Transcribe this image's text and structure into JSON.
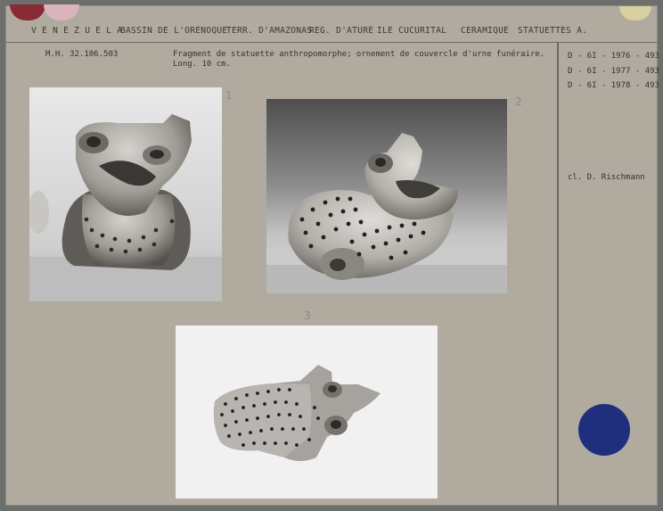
{
  "header": {
    "country": "V E N E Z U E L A",
    "region": "BASSIN DE L'ORENOQUE",
    "territory": "TERR. D'AMAZONAS",
    "reg": "REG. D'ATURE",
    "site": "ILE CUCURITAL",
    "category": "CERAMIQUE",
    "subcategory": "STATUETTES A."
  },
  "record": {
    "inventory": "M.H. 32.106.503",
    "description_line1": "Fragment de statuette anthropomorphe; ornement de couvercle d'urne funéraire.",
    "description_line2": "Long. 10 cm."
  },
  "references": [
    "D - 6I - 1976 - 493",
    "D - 6I - 1977 - 493",
    "D - 6I - 1978 - 493"
  ],
  "credit": "cl. D. Rischmann",
  "photos": [
    {
      "caption": "photo-1",
      "pencil": "1"
    },
    {
      "caption": "photo-2",
      "pencil": "2"
    },
    {
      "caption": "photo-3",
      "pencil": "3"
    }
  ],
  "colors": {
    "card": "#b0aa9f",
    "sticker_blue": "#1f2f7e",
    "sticker_red": "#8a2a34",
    "sticker_pink": "#d9b3bd"
  }
}
